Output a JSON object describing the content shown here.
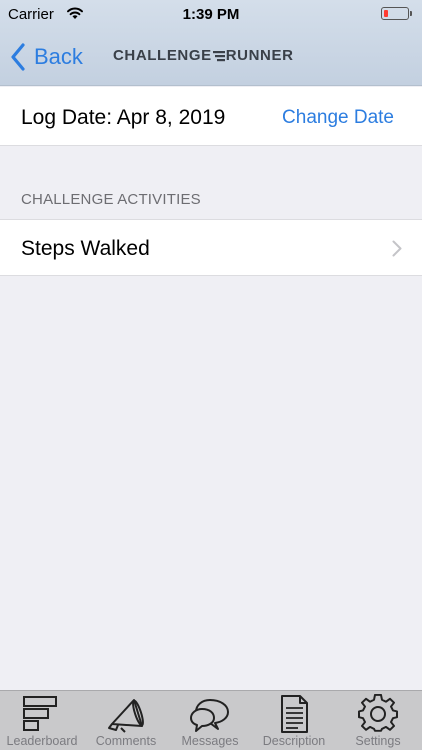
{
  "status_bar": {
    "carrier": "Carrier",
    "time": "1:39 PM"
  },
  "nav": {
    "back_label": "Back",
    "brand_left": "CHALLENGE",
    "brand_right": "RUNNER"
  },
  "log": {
    "date_text": "Log Date: Apr 8, 2019",
    "change_label": "Change Date"
  },
  "section": {
    "title": "CHALLENGE ACTIVITIES"
  },
  "activities": [
    {
      "label": "Steps Walked"
    }
  ],
  "tabs": [
    {
      "label": "Leaderboard",
      "icon": "leaderboard-icon"
    },
    {
      "label": "Comments",
      "icon": "megaphone-icon"
    },
    {
      "label": "Messages",
      "icon": "chat-bubbles-icon"
    },
    {
      "label": "Description",
      "icon": "document-icon"
    },
    {
      "label": "Settings",
      "icon": "gear-icon"
    }
  ],
  "colors": {
    "accent": "#2c7de0",
    "battery_low": "#ff3b30",
    "background": "#efeff4"
  }
}
